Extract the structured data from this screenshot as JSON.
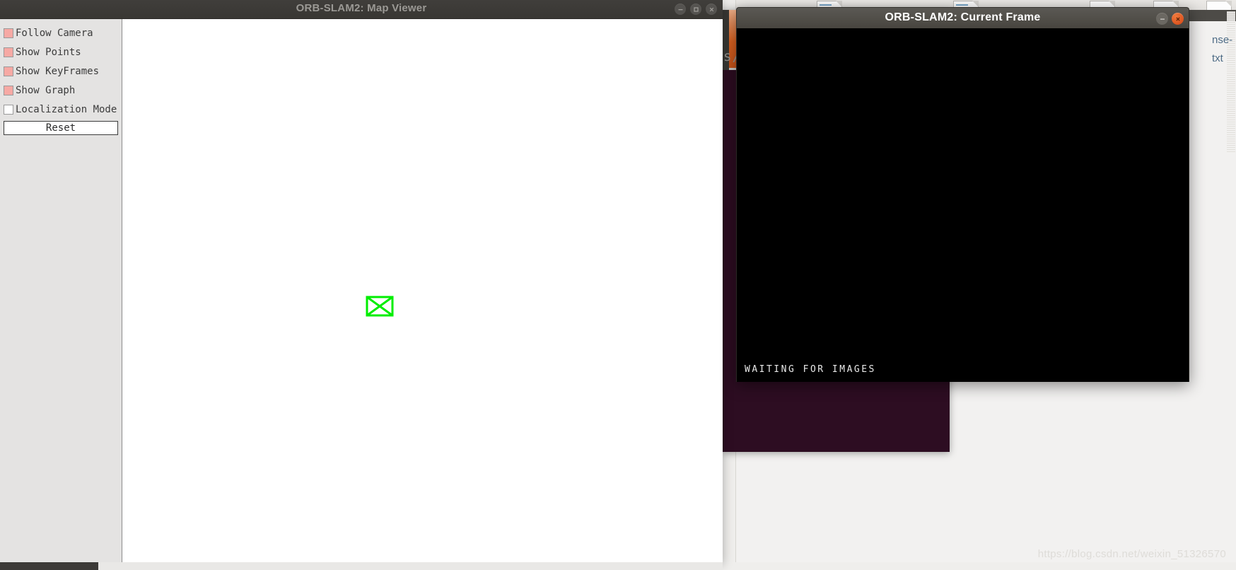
{
  "desktop": {
    "watermark": "https://blog.csdn.net/weixin_51326570",
    "background_color": "#efeeec"
  },
  "background_windows": {
    "file_manager": {
      "name": "file-manager",
      "visible_filename_fragments": [
        "nse-",
        "txt"
      ],
      "document_icon_count": 5
    },
    "terminal": {
      "name": "terminal",
      "visible_text": "s/s",
      "background_color": "#2d0d22"
    }
  },
  "map_viewer_window": {
    "title": "ORB-SLAM2: Map Viewer",
    "active": false,
    "titlebar_color": "#3c3a37",
    "title_color": "#9b9995",
    "controls": [
      {
        "name": "minimize-button",
        "glyph": "minimize"
      },
      {
        "name": "maximize-button",
        "glyph": "maximize"
      },
      {
        "name": "close-button",
        "glyph": "close"
      }
    ],
    "sidebar": {
      "checkboxes": [
        {
          "label": "Follow Camera",
          "checked": true
        },
        {
          "label": "Show Points",
          "checked": true
        },
        {
          "label": "Show KeyFrames",
          "checked": true
        },
        {
          "label": "Show Graph",
          "checked": true
        },
        {
          "label": "Localization Mode",
          "checked": false
        }
      ],
      "checked_color": "#f6a9a4",
      "reset_button_label": "Reset"
    },
    "canvas": {
      "background_color": "#ffffff",
      "camera_frustum_color": "#00ee00"
    }
  },
  "current_frame_window": {
    "title": "ORB-SLAM2: Current Frame",
    "active": true,
    "title_color": "#ffffff",
    "viewport_background": "#000000",
    "status_text": "WAITING FOR IMAGES",
    "controls": [
      {
        "name": "minimize-button",
        "glyph": "minimize"
      },
      {
        "name": "close-button",
        "glyph": "close",
        "color": "#dd5a26"
      }
    ]
  }
}
